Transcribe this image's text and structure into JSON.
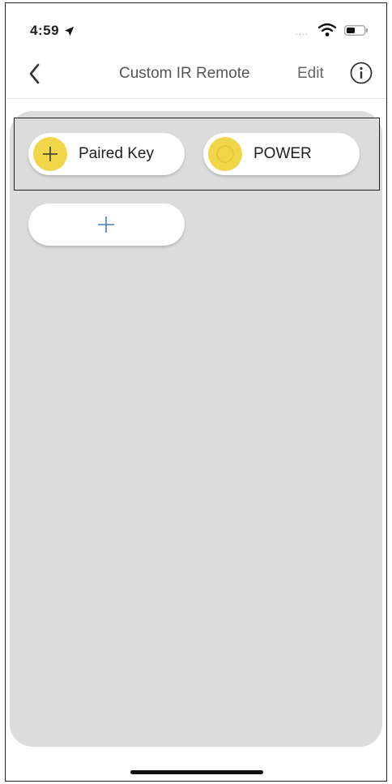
{
  "status_bar": {
    "time": "4:59",
    "signal": "....",
    "icons": [
      "location-arrow-icon",
      "wifi-icon",
      "battery-icon"
    ]
  },
  "nav": {
    "title": "Custom IR Remote",
    "edit_label": "Edit",
    "back_icon": "chevron-left-icon",
    "info_icon": "info-icon"
  },
  "keys": [
    {
      "label": "Paired Key",
      "icon": "plus-icon",
      "badge_color": "#f1d64a"
    },
    {
      "label": "POWER",
      "icon": "circle-icon",
      "badge_color": "#f1d64a"
    }
  ],
  "add_key": {
    "icon": "plus-icon",
    "color": "#3f7fbf"
  },
  "colors": {
    "canvas": "#dcdcdc",
    "accent_yellow": "#f1d64a"
  }
}
